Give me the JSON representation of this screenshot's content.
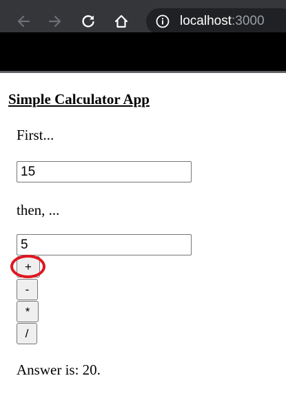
{
  "browser": {
    "url_host": "localhost",
    "url_port": ":3000",
    "icons": {
      "back": "arrow-left-icon",
      "forward": "arrow-right-icon",
      "reload": "reload-icon",
      "home": "home-icon",
      "site_info": "info-icon"
    }
  },
  "page": {
    "title": "Simple Calculator App",
    "first_label": "First...",
    "first_value": "15",
    "second_label": "then, ...",
    "second_value": "5",
    "operations": [
      "+",
      "-",
      "*",
      "/"
    ],
    "answer_text": "Answer is: 20."
  },
  "annotation": {
    "highlighted_button": "+",
    "color": "#e0161f"
  },
  "colors": {
    "chrome_bg": "#35363a",
    "omnibox_bg": "#202124",
    "port_text": "#9aa0a6"
  }
}
